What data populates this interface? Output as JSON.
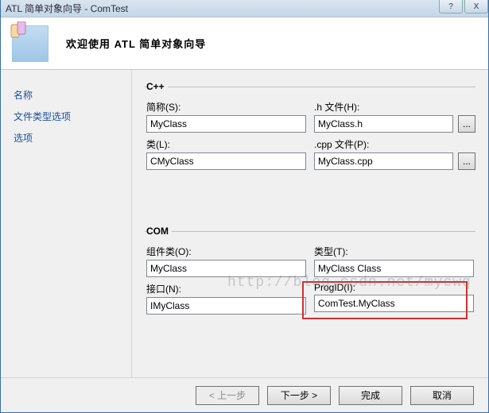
{
  "window": {
    "title": "ATL 简单对象向导 - ComTest",
    "help_glyph": "?",
    "close_glyph": "X"
  },
  "header": {
    "title": "欢迎使用 ATL 简单对象向导"
  },
  "sidebar": {
    "items": [
      {
        "label": "名称"
      },
      {
        "label": "文件类型选项"
      },
      {
        "label": "选项"
      }
    ]
  },
  "cpp": {
    "legend": "C++",
    "short_name_label": "简称(S):",
    "short_name_value": "MyClass",
    "h_file_label": ".h 文件(H):",
    "h_file_value": "MyClass.h",
    "class_label": "类(L):",
    "class_value": "CMyClass",
    "cpp_file_label": ".cpp 文件(P):",
    "cpp_file_value": "MyClass.cpp",
    "browse_glyph": "..."
  },
  "com": {
    "legend": "COM",
    "coclass_label": "组件类(O):",
    "coclass_value": "MyClass",
    "type_label": "类型(T):",
    "type_value": "MyClass Class",
    "interface_label": "接口(N):",
    "interface_value": "IMyClass",
    "progid_label": "ProgID(I):",
    "progid_value": "ComTest.MyClass"
  },
  "footer": {
    "back": "< 上一步",
    "next": "下一步 >",
    "finish": "完成",
    "cancel": "取消"
  },
  "watermark": "http://blog.csdn.net/mycwq"
}
